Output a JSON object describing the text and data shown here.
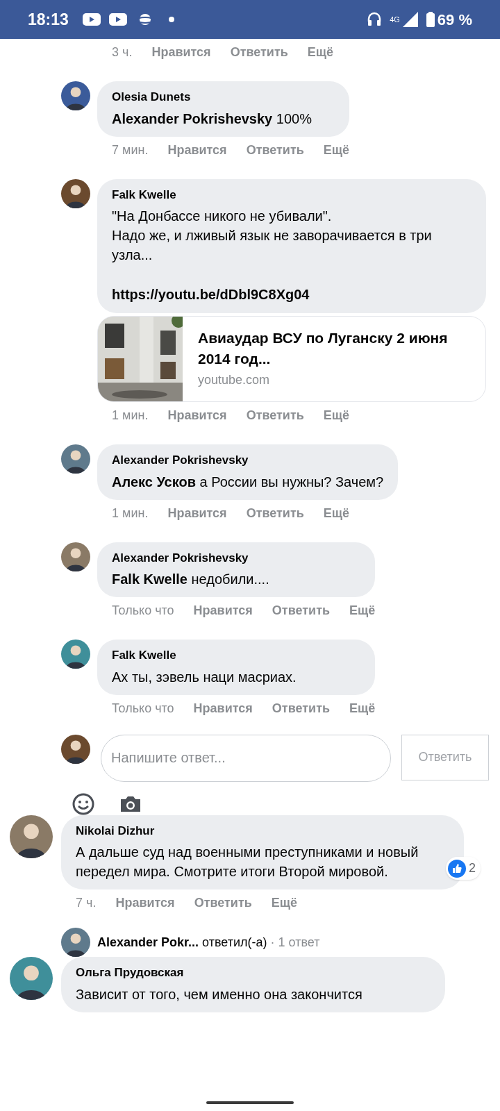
{
  "status_bar": {
    "time": "18:13",
    "network": "4G",
    "battery": "69 %"
  },
  "top_actions": {
    "time": "3 ч.",
    "like": "Нравится",
    "reply": "Ответить",
    "more": "Ещё"
  },
  "replies": [
    {
      "author": "Olesia Dunets",
      "text": "**Alexander Pokrishevsky** 100%",
      "actions": {
        "time": "7 мин.",
        "like": "Нравится",
        "reply": "Ответить",
        "more": "Ещё"
      }
    },
    {
      "author": "Falk Kwelle",
      "text": "\"На Донбассе никого не убивали\".\nНадо же, и лживый язык не заворачивается в три узла...",
      "link": "https://youtu.be/dDbl9C8Xg04",
      "preview": {
        "title": "Авиаудар ВСУ по Луганску 2 июня 2014 год...",
        "domain": "youtube.com"
      },
      "actions": {
        "time": "1 мин.",
        "like": "Нравится",
        "reply": "Ответить",
        "more": "Ещё"
      }
    },
    {
      "author": "Alexander Pokrishevsky",
      "text": "**Алекс Усков** а России вы нужны? Зачем?",
      "actions": {
        "time": "1 мин.",
        "like": "Нравится",
        "reply": "Ответить",
        "more": "Ещё"
      }
    },
    {
      "author": "Alexander Pokrishevsky",
      "text": "**Falk Kwelle** недобили....",
      "actions": {
        "time": "Только что",
        "like": "Нравится",
        "reply": "Ответить",
        "more": "Ещё"
      }
    },
    {
      "author": "Falk Kwelle",
      "text": "Ах ты, зэвель наци масриах.",
      "actions": {
        "time": "Только что",
        "like": "Нравится",
        "reply": "Ответить",
        "more": "Ещё"
      }
    }
  ],
  "reply_box": {
    "placeholder": "Напишите ответ...",
    "button": "Ответить"
  },
  "comments": [
    {
      "author": "Nikolai Dizhur",
      "text": "А дальше суд над военными преступниками и новый передел мира. Смотрите итоги Второй мировой.",
      "reactions": "2",
      "actions": {
        "time": "7 ч.",
        "like": "Нравится",
        "reply": "Ответить",
        "more": "Ещё"
      },
      "reply_summary": {
        "author": "Alexander Pokr...",
        "verb": "ответил(-а)",
        "count": "· 1 ответ"
      }
    },
    {
      "author": "Ольга Прудовская",
      "text": "Зависит от того, чем именно она закончится"
    }
  ]
}
